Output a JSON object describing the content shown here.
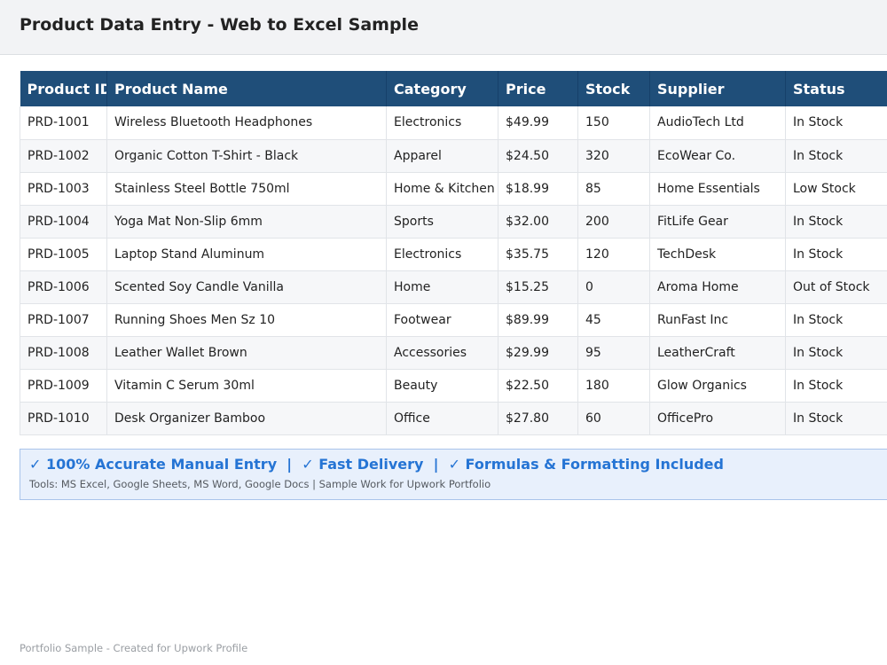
{
  "header": {
    "title": "Product Data Entry - Web to Excel Sample"
  },
  "table": {
    "columns": [
      "Product ID",
      "Product Name",
      "Category",
      "Price",
      "Stock",
      "Supplier",
      "Status"
    ],
    "rows": [
      [
        "PRD-1001",
        "Wireless Bluetooth Headphones",
        "Electronics",
        "$49.99",
        "150",
        "AudioTech Ltd",
        "In Stock"
      ],
      [
        "PRD-1002",
        "Organic Cotton T-Shirt - Black",
        "Apparel",
        "$24.50",
        "320",
        "EcoWear Co.",
        "In Stock"
      ],
      [
        "PRD-1003",
        "Stainless Steel Bottle 750ml",
        "Home & Kitchen",
        "$18.99",
        "85",
        "Home Essentials",
        "Low Stock"
      ],
      [
        "PRD-1004",
        "Yoga Mat Non-Slip 6mm",
        "Sports",
        "$32.00",
        "200",
        "FitLife Gear",
        "In Stock"
      ],
      [
        "PRD-1005",
        "Laptop Stand Aluminum",
        "Electronics",
        "$35.75",
        "120",
        "TechDesk",
        "In Stock"
      ],
      [
        "PRD-1006",
        "Scented Soy Candle Vanilla",
        "Home",
        "$15.25",
        "0",
        "Aroma Home",
        "Out of Stock"
      ],
      [
        "PRD-1007",
        "Running Shoes Men Sz 10",
        "Footwear",
        "$89.99",
        "45",
        "RunFast Inc",
        "In Stock"
      ],
      [
        "PRD-1008",
        "Leather Wallet Brown",
        "Accessories",
        "$29.99",
        "95",
        "LeatherCraft",
        "In Stock"
      ],
      [
        "PRD-1009",
        "Vitamin C Serum 30ml",
        "Beauty",
        "$22.50",
        "180",
        "Glow Organics",
        "In Stock"
      ],
      [
        "PRD-1010",
        "Desk Organizer Bamboo",
        "Office",
        "$27.80",
        "60",
        "OfficePro",
        "In Stock"
      ]
    ]
  },
  "banner": {
    "headline": "✓ 100% Accurate Manual Entry  |  ✓ Fast Delivery  |  ✓ Formulas & Formatting Included",
    "tools": "Tools: MS Excel, Google Sheets, MS Word, Google Docs | Sample Work for Upwork Portfolio"
  },
  "footer": {
    "text": "Portfolio Sample - Created for Upwork Profile"
  },
  "colors": {
    "header_bg": "#1f4e79",
    "accent": "#2574d4",
    "banner_bg": "#e8f0fc"
  }
}
